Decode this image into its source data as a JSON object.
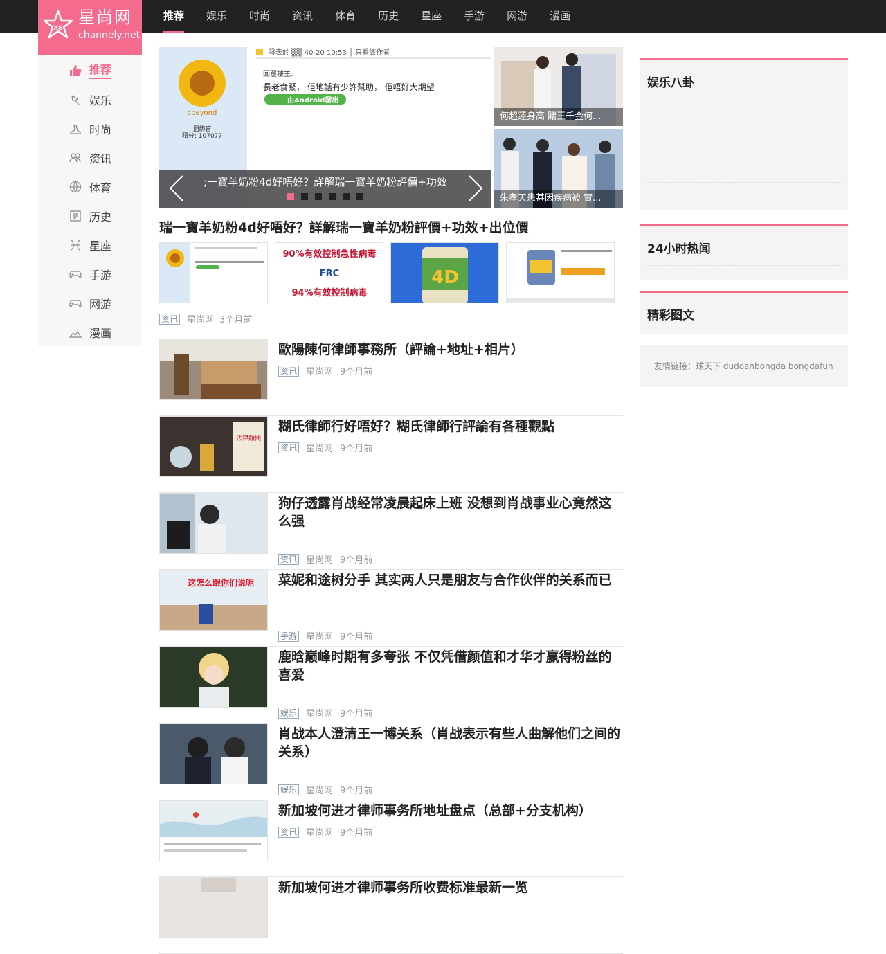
{
  "brand": {
    "name": "星尚网",
    "domain": "channely.net",
    "mark": "xs"
  },
  "topnav": [
    "推荐",
    "娱乐",
    "时尚",
    "资讯",
    "体育",
    "历史",
    "星座",
    "手游",
    "网游",
    "漫画"
  ],
  "sidebar": [
    {
      "label": "推荐",
      "icon": "thumb-up-icon"
    },
    {
      "label": "娱乐",
      "icon": "bell-icon"
    },
    {
      "label": "时尚",
      "icon": "shoe-icon"
    },
    {
      "label": "资讯",
      "icon": "people-icon"
    },
    {
      "label": "体育",
      "icon": "ball-icon"
    },
    {
      "label": "历史",
      "icon": "book-icon"
    },
    {
      "label": "星座",
      "icon": "pisces-icon"
    },
    {
      "label": "手游",
      "icon": "gamepad-icon"
    },
    {
      "label": "网游",
      "icon": "gamepad-icon"
    },
    {
      "label": "漫画",
      "icon": "mountain-icon"
    }
  ],
  "slider": {
    "caption": ";一寶羊奶粉4d好唔好？詳解瑞一寶羊奶粉評價+功效",
    "image_text": {
      "post_header": "發表於 ▒▒ 40-20 10:53 │ 只看該作者",
      "reply_label": "回覆樓主:",
      "reply_body": "長老食緊， 佢地話有少許幫助， 佢唔好大期望",
      "android_badge": "由Android發出",
      "username": "cbeyond",
      "user_role": "捆綁官",
      "user_points": "積分: 107077"
    },
    "dot_count": 6,
    "active_dot": 0
  },
  "featured": [
    {
      "caption": "何超蓮身高 賭王千金何..."
    },
    {
      "caption": "朱孝天患甚因疾病被 實..."
    }
  ],
  "headline": {
    "title": "瑞一寶羊奶粉4d好唔好？詳解瑞一寶羊奶粉評價+功效+出位價",
    "tag": "资讯",
    "source": "星尚网",
    "time": "3个月前",
    "thumb_text": {
      "frc_top": "90%有效控制急性病毒",
      "frc_logo": "FRC",
      "frc_bottom": "94%有效控制病毒",
      "can_label": "4D"
    }
  },
  "articles": [
    {
      "title": "歐陽陳何律師事務所（評論+地址+相片）",
      "tag": "资讯",
      "source": "星尚网",
      "time": "9个月前",
      "pic": "office"
    },
    {
      "title": "糊氏律師行好唔好？糊氏律師行評論有各種觀點",
      "tag": "资讯",
      "source": "星尚网",
      "time": "9个月前",
      "pic": "award",
      "pic_text": "法律顧問"
    },
    {
      "title": "狗仔透露肖战经常凌晨起床上班 没想到肖战事业心竟然这么强",
      "tag": "资讯",
      "source": "星尚网",
      "time": "9个月前",
      "pic": "man"
    },
    {
      "title": "菜妮和途树分手 其实两人只是朋友与合作伙伴的关系而已",
      "tag": "手游",
      "source": "星尚网",
      "time": "9个月前",
      "pic": "snow",
      "pic_text": "这怎么跟你们说呢"
    },
    {
      "title": "鹿晗巅峰时期有多夸张 不仅凭借颜值和才华才赢得粉丝的喜爱",
      "tag": "娱乐",
      "source": "星尚网",
      "time": "9个月前",
      "pic": "blond"
    },
    {
      "title": "肖战本人澄清王一博关系（肖战表示有些人曲解他们之间的关系）",
      "tag": "娱乐",
      "source": "星尚网",
      "time": "9个月前",
      "pic": "duo"
    },
    {
      "title": "新加坡何进才律师事务所地址盘点（总部+分支机构）",
      "tag": "资讯",
      "source": "星尚网",
      "time": "9个月前",
      "pic": "map"
    },
    {
      "title": "新加坡何进才律师事务所收费标准最新一览",
      "tag": "",
      "source": "",
      "time": "",
      "pic": "blank"
    }
  ],
  "right": {
    "box1": "娱乐八卦",
    "box2": "24小时热闻",
    "box3": "精彩图文",
    "friend_label": "友情链接：",
    "friend_links": [
      "球天下",
      "dudoanbongda",
      "bongdafun"
    ]
  },
  "colors": {
    "accent": "#f46b8e",
    "topbar": "#222222"
  }
}
